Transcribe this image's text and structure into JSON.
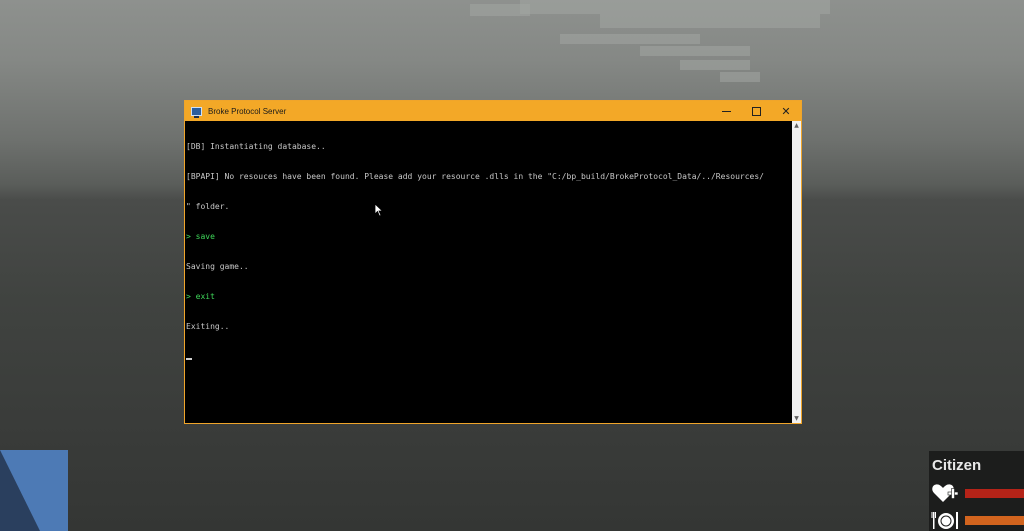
{
  "window": {
    "title": "Broke Protocol Server",
    "minimize_label": "",
    "close_label": "✕"
  },
  "console": {
    "lines": [
      {
        "text": "[DB] Instantiating database..",
        "type": "output"
      },
      {
        "text": "[BPAPI] No resouces have been found. Please add your resource .dlls in the \"C:/bp_build/BrokeProtocol_Data/../Resources/",
        "type": "output"
      },
      {
        "text": "\" folder.",
        "type": "output"
      },
      {
        "text": "> save",
        "type": "command"
      },
      {
        "text": "Saving game..",
        "type": "output"
      },
      {
        "text": "> exit",
        "type": "command"
      },
      {
        "text": "Exiting..",
        "type": "output"
      }
    ]
  },
  "hud": {
    "role": "Citizen",
    "health_color": "#b52318",
    "food_color": "#d2641e"
  },
  "colors": {
    "title_bar": "#f3a827",
    "command_text": "#3fd85a",
    "output_text": "#c8c8c8"
  }
}
